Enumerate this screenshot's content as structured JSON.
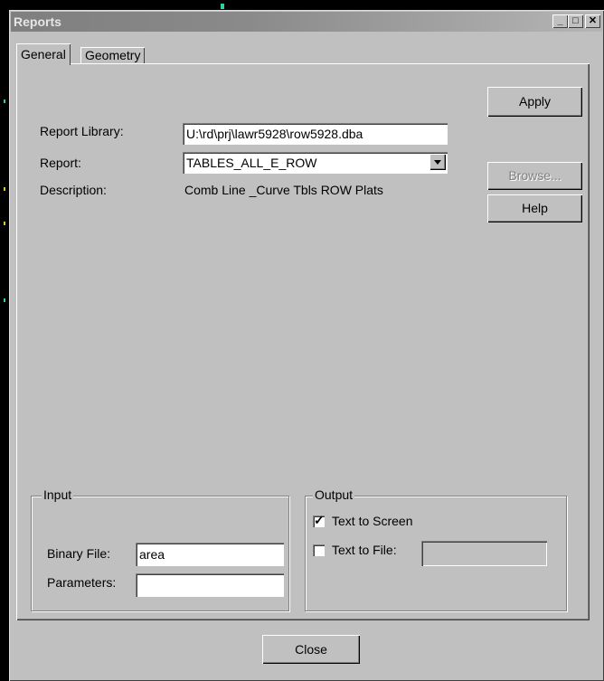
{
  "window": {
    "title": "Reports"
  },
  "tabs": [
    {
      "label": "General"
    },
    {
      "label": "Geometry"
    }
  ],
  "general": {
    "report_library_label": "Report Library:",
    "report_library_value": "U:\\rd\\prj\\lawr5928\\row5928.dba",
    "report_label": "Report:",
    "report_value": "TABLES_ALL_E_ROW",
    "description_label": "Description:",
    "description_value": "Comb Line _Curve  Tbls ROW Plats"
  },
  "buttons": {
    "apply": "Apply",
    "browse": "Browse...",
    "help": "Help",
    "close": "Close"
  },
  "input_group": {
    "title": "Input",
    "binary_file_label": "Binary File:",
    "binary_file_value": "area",
    "parameters_label": "Parameters:",
    "parameters_value": ""
  },
  "output_group": {
    "title": "Output",
    "text_to_screen_label": "Text to Screen",
    "text_to_screen_checked": true,
    "text_to_file_label": "Text to File:",
    "text_to_file_checked": false,
    "text_to_file_value": ""
  },
  "icons": {
    "minimize": "minimize-icon",
    "maximize": "maximize-icon",
    "close": "close-icon",
    "dropdown": "chevron-down-icon",
    "check": "checkmark-icon"
  },
  "colors": {
    "titlebar": "#808080",
    "face": "#c0c0c0"
  }
}
